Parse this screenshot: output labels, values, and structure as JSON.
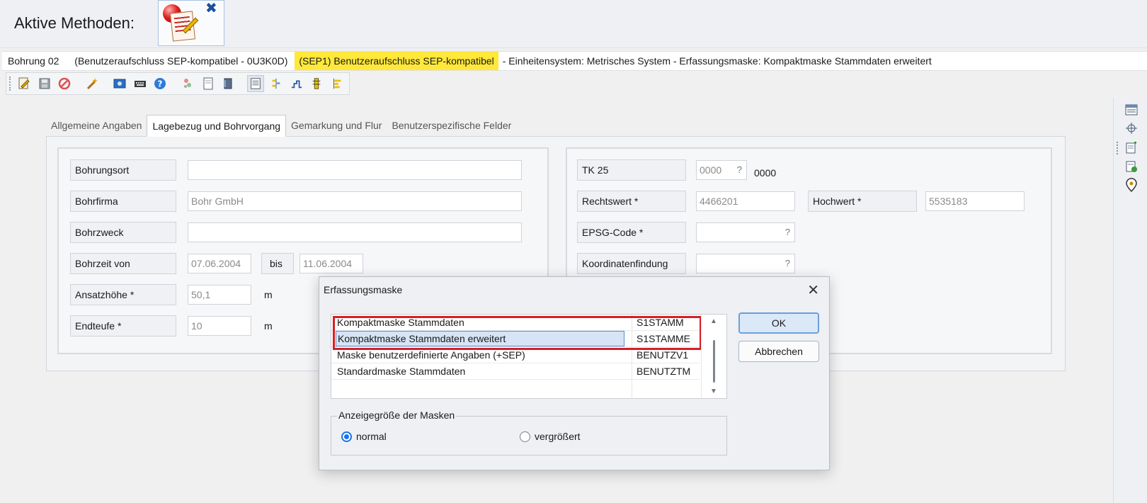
{
  "header": {
    "title": "Aktive Methoden:"
  },
  "status_bar": {
    "bohrung": "Bohrung 02",
    "benutzer": "(Benutzeraufschluss SEP-kompatibel - 0U3K0D)",
    "sep": "(SEP1) Benutzeraufschluss SEP-kompatibel",
    "rest": "-  Einheitensystem: Metrisches System  -  Erfassungsmaske: Kompaktmaske Stammdaten erweitert"
  },
  "tabs": [
    {
      "label": "Allgemeine Angaben"
    },
    {
      "label": "Lagebezug und Bohrvorgang"
    },
    {
      "label": "Gemarkung und Flur"
    },
    {
      "label": "Benutzerspezifische Felder"
    }
  ],
  "form_left": {
    "bohrungsort": {
      "label": "Bohrungsort",
      "value": ""
    },
    "bohrfirma": {
      "label": "Bohrfirma",
      "value": "Bohr GmbH"
    },
    "bohrzweck": {
      "label": "Bohrzweck",
      "value": ""
    },
    "bohrzeit": {
      "label": "Bohrzeit von",
      "von": "07.06.2004",
      "bis_label": "bis",
      "bis": "11.06.2004"
    },
    "ansatzhoehe": {
      "label": "Ansatzhöhe *",
      "value": "50,1",
      "unit": "m"
    },
    "endteufe": {
      "label": "Endteufe *",
      "value": "10",
      "unit": "m"
    }
  },
  "form_right": {
    "tk25": {
      "label": "TK 25",
      "value": "0000",
      "help": "?",
      "display": "0000"
    },
    "rechtswert": {
      "label": "Rechtswert *",
      "value": "4466201"
    },
    "hochwert": {
      "label": "Hochwert *",
      "value": "5535183"
    },
    "epsg": {
      "label": "EPSG-Code *",
      "value": "",
      "help": "?"
    },
    "koordinaten": {
      "label": "Koordinatenfindung",
      "value": "",
      "help": "?"
    }
  },
  "dialog": {
    "title": "Erfassungsmaske",
    "close_symbol": "✕",
    "rows": [
      {
        "name": "Kompaktmaske Stammdaten",
        "code": "S1STAMM"
      },
      {
        "name": "Kompaktmaske Stammdaten erweitert",
        "code": "S1STAMME"
      },
      {
        "name": "Maske benutzerdefinierte Angaben (+SEP)",
        "code": "BENUTZV1"
      },
      {
        "name": "Standardmaske Stammdaten",
        "code": "BENUTZTM"
      }
    ],
    "selected_row": 1,
    "ok_label": "OK",
    "cancel_label": "Abbrechen",
    "size_group": {
      "legend": "Anzeigegröße der Masken",
      "options": [
        {
          "label": "normal",
          "checked": true
        },
        {
          "label": "vergrößert",
          "checked": false
        }
      ]
    }
  },
  "colors": {
    "highlight_yellow": "#ffe83a",
    "selection_red": "#d61f26",
    "accent_blue": "#1a73e8"
  }
}
